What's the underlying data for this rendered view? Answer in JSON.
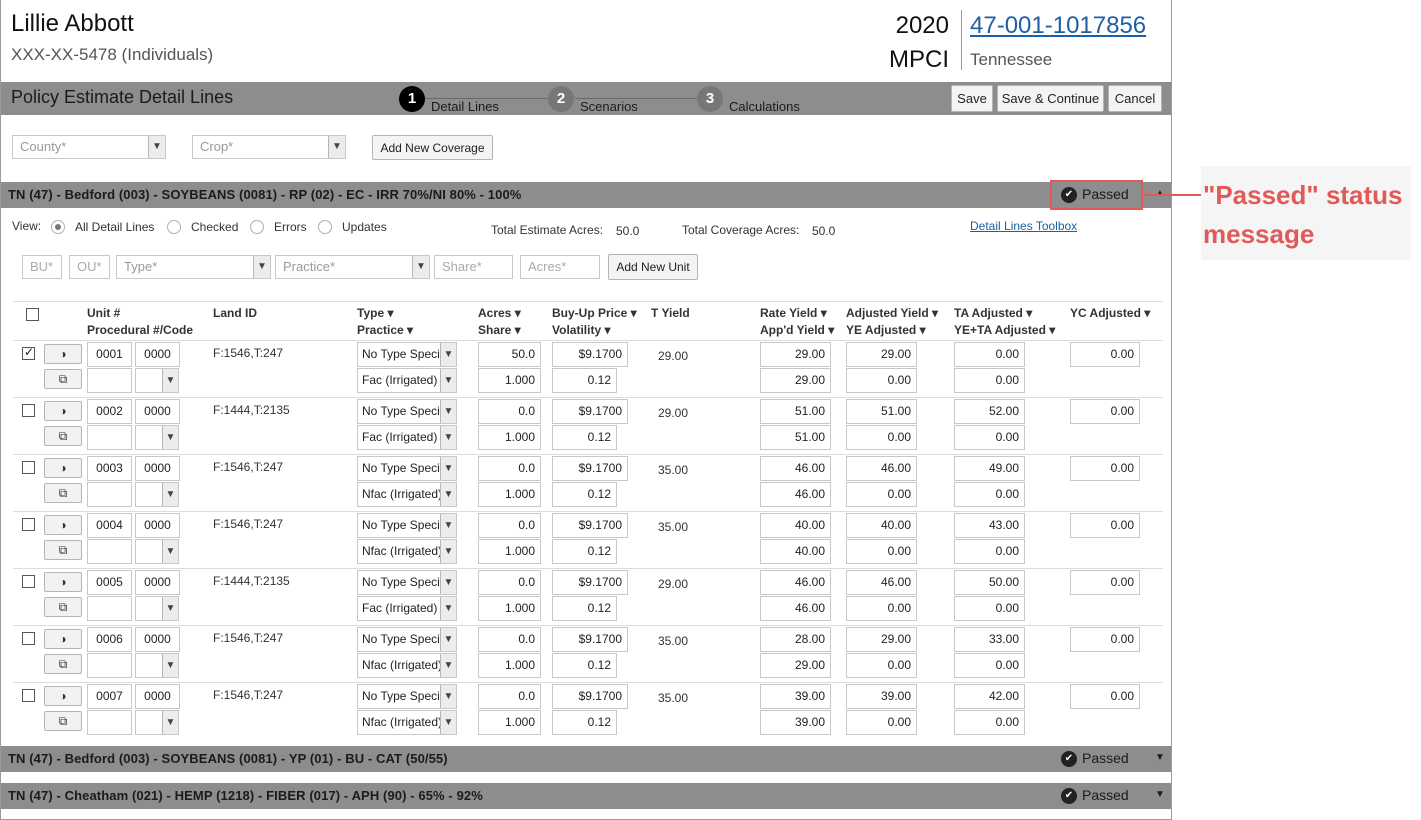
{
  "client": {
    "name": "Lillie Abbott",
    "ssn": "XXX-XX-5478 (Individuals)"
  },
  "policy": {
    "year": "2020",
    "program": "MPCI",
    "number": "47-001-1017856",
    "state": "Tennessee"
  },
  "toolbar": {
    "title": "Policy Estimate Detail Lines",
    "steps": [
      {
        "num": "1",
        "label": "Detail Lines"
      },
      {
        "num": "2",
        "label": "Scenarios"
      },
      {
        "num": "3",
        "label": "Calculations"
      }
    ],
    "save": "Save",
    "save_continue": "Save & Continue",
    "cancel": "Cancel"
  },
  "filters": {
    "county": "County*",
    "crop": "Crop*",
    "add_coverage": "Add New Coverage"
  },
  "sections": [
    {
      "title": "TN (47) - Bedford (003) - SOYBEANS (0081) - RP (02) - EC - IRR 70%/NI 80% - 100%",
      "status": "Passed"
    },
    {
      "title": "TN (47) - Bedford (003) - SOYBEANS (0081) - YP (01) - BU - CAT (50/55)",
      "status": "Passed"
    },
    {
      "title": "TN (47) - Cheatham (021) - HEMP (1218) - FIBER (017) - APH (90) - 65% - 92%",
      "status": "Passed"
    }
  ],
  "view": {
    "label": "View:",
    "options": [
      "All Detail Lines",
      "Checked",
      "Errors",
      "Updates"
    ],
    "total_estimate_label": "Total Estimate Acres:",
    "total_estimate": "50.0",
    "total_coverage_label": "Total Coverage Acres:",
    "total_coverage": "50.0",
    "toolbox": "Detail Lines Toolbox"
  },
  "unit_form": {
    "bu": "BU*",
    "ou": "OU*",
    "type": "Type*",
    "practice": "Practice*",
    "share": "Share*",
    "acres": "Acres*",
    "add_unit": "Add New Unit"
  },
  "table": {
    "headers": {
      "unit": "Unit #",
      "procedural": "Procedural #/Code",
      "land_id": "Land ID",
      "type": "Type ▾",
      "practice": "Practice ▾",
      "acres": "Acres ▾",
      "share": "Share ▾",
      "buyup": "Buy-Up Price ▾",
      "volatility": "Volatility ▾",
      "tyield": "T Yield",
      "rate_yield": "Rate Yield ▾",
      "appd_yield": "App'd Yield ▾",
      "adj_yield": "Adjusted Yield ▾",
      "ye_adj": "YE Adjusted ▾",
      "ta_adj": "TA Adjusted ▾",
      "yeta_adj": "YE+TA Adjusted ▾",
      "yc_adj": "YC Adjusted ▾"
    },
    "rows": [
      {
        "checked": true,
        "unit": "0001",
        "code": "0000",
        "land": "F:1546,T:247",
        "type": "No Type Specified",
        "practice": "Fac (Irrigated)",
        "acres": "50.0",
        "share": "1.000",
        "price": "$9.1700",
        "vol": "0.12",
        "tyield": "29.00",
        "rate": "29.00",
        "appd": "29.00",
        "adj": "29.00",
        "ye": "0.00",
        "ta": "0.00",
        "yeta": "0.00",
        "yc": "0.00"
      },
      {
        "checked": false,
        "unit": "0002",
        "code": "0000",
        "land": "F:1444,T:2135",
        "type": "No Type Specified",
        "practice": "Fac (Irrigated)",
        "acres": "0.0",
        "share": "1.000",
        "price": "$9.1700",
        "vol": "0.12",
        "tyield": "29.00",
        "rate": "51.00",
        "appd": "51.00",
        "adj": "51.00",
        "ye": "0.00",
        "ta": "52.00",
        "yeta": "0.00",
        "yc": "0.00"
      },
      {
        "checked": false,
        "unit": "0003",
        "code": "0000",
        "land": "F:1546,T:247",
        "type": "No Type Specified",
        "practice": "Nfac (Irrigated)",
        "acres": "0.0",
        "share": "1.000",
        "price": "$9.1700",
        "vol": "0.12",
        "tyield": "35.00",
        "rate": "46.00",
        "appd": "46.00",
        "adj": "46.00",
        "ye": "0.00",
        "ta": "49.00",
        "yeta": "0.00",
        "yc": "0.00"
      },
      {
        "checked": false,
        "unit": "0004",
        "code": "0000",
        "land": "F:1546,T:247",
        "type": "No Type Specified",
        "practice": "Nfac (Irrigated)",
        "acres": "0.0",
        "share": "1.000",
        "price": "$9.1700",
        "vol": "0.12",
        "tyield": "35.00",
        "rate": "40.00",
        "appd": "40.00",
        "adj": "40.00",
        "ye": "0.00",
        "ta": "43.00",
        "yeta": "0.00",
        "yc": "0.00"
      },
      {
        "checked": false,
        "unit": "0005",
        "code": "0000",
        "land": "F:1444,T:2135",
        "type": "No Type Specified",
        "practice": "Fac (Irrigated)",
        "acres": "0.0",
        "share": "1.000",
        "price": "$9.1700",
        "vol": "0.12",
        "tyield": "29.00",
        "rate": "46.00",
        "appd": "46.00",
        "adj": "46.00",
        "ye": "0.00",
        "ta": "50.00",
        "yeta": "0.00",
        "yc": "0.00"
      },
      {
        "checked": false,
        "unit": "0006",
        "code": "0000",
        "land": "F:1546,T:247",
        "type": "No Type Specified",
        "practice": "Nfac (Irrigated)",
        "acres": "0.0",
        "share": "1.000",
        "price": "$9.1700",
        "vol": "0.12",
        "tyield": "35.00",
        "rate": "28.00",
        "appd": "29.00",
        "adj": "29.00",
        "ye": "0.00",
        "ta": "33.00",
        "yeta": "0.00",
        "yc": "0.00"
      },
      {
        "checked": false,
        "unit": "0007",
        "code": "0000",
        "land": "F:1546,T:247",
        "type": "No Type Specified",
        "practice": "Nfac (Irrigated)",
        "acres": "0.0",
        "share": "1.000",
        "price": "$9.1700",
        "vol": "0.12",
        "tyield": "35.00",
        "rate": "39.00",
        "appd": "39.00",
        "adj": "39.00",
        "ye": "0.00",
        "ta": "42.00",
        "yeta": "0.00",
        "yc": "0.00"
      }
    ]
  },
  "annotation": {
    "text": "\"Passed\" status message",
    "color": "#e15a5a"
  },
  "colors": {
    "bar": "#8d8d8d",
    "link": "#1f5fa5",
    "annotation": "#e15a5a"
  },
  "icons": {
    "passed": "check-circle-icon",
    "row_action_1": "contrast-icon",
    "row_action_2": "copy-icon"
  }
}
